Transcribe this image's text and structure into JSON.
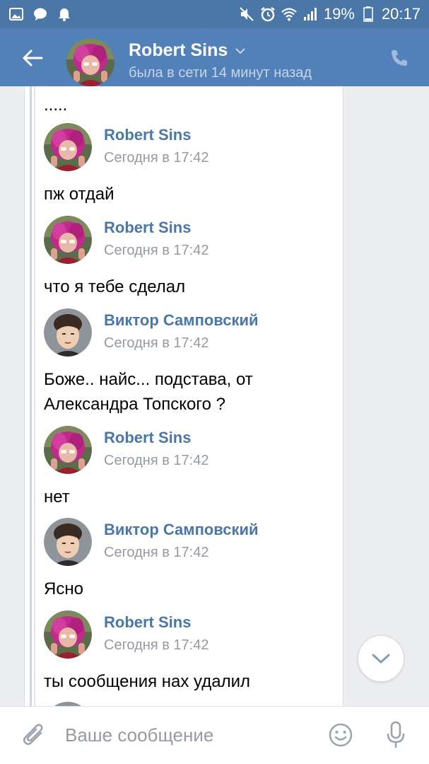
{
  "status_bar": {
    "battery": "19%",
    "time": "20:17",
    "icons": [
      "image-icon",
      "message-icon",
      "bell-icon",
      "mute-icon",
      "alarm-icon",
      "wifi-icon",
      "signal-icon",
      "battery-icon"
    ]
  },
  "header": {
    "name": "Robert Sins",
    "status": "была в сети 14 минут назад"
  },
  "messages": [
    {
      "text": "....."
    },
    {
      "author": "Robert Sins",
      "time": "Сегодня в 17:42",
      "text": "пж отдай",
      "avatar": "robert"
    },
    {
      "author": "Robert Sins",
      "time": "Сегодня в 17:42",
      "text": "что я тебе сделал",
      "avatar": "robert"
    },
    {
      "author": "Виктор Самповский",
      "time": "Сегодня в 17:42",
      "text_line1": "Боже.. найс... подстава, от",
      "text_line2": "Александра Топского ?",
      "avatar": "viktor"
    },
    {
      "author": "Robert Sins",
      "time": "Сегодня в 17:42",
      "text": "нет",
      "avatar": "robert"
    },
    {
      "author": "Виктор Самповский",
      "time": "Сегодня в 17:42",
      "text": "Ясно",
      "avatar": "viktor"
    },
    {
      "author": "Robert Sins",
      "time": "Сегодня в 17:42",
      "text": "ты сообщения нах удалил",
      "avatar": "robert"
    }
  ],
  "composer": {
    "placeholder": "Ваше сообщение"
  },
  "colors": {
    "header_bg": "#5181b8",
    "status_bg": "#4a76a8",
    "name_link": "#4a76a8",
    "time_gray": "#939aa3"
  }
}
